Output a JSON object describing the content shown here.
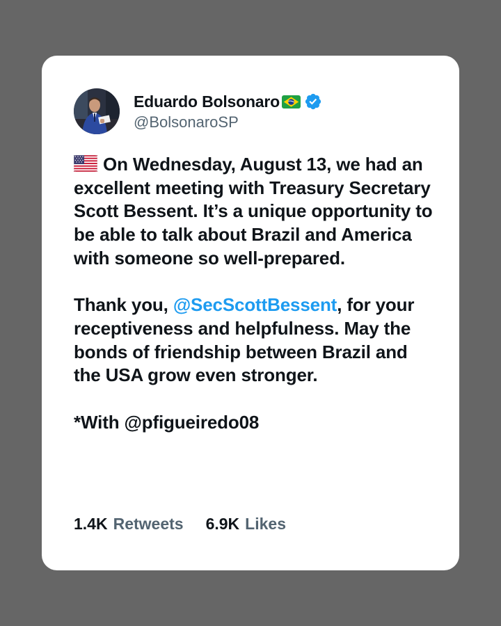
{
  "author": {
    "display_name": "Eduardo Bolsonaro",
    "handle": "@BolsonaroSP",
    "verified": true,
    "name_flag_icon": "brazil-flag-icon",
    "verified_icon": "verified-badge-icon"
  },
  "post": {
    "flag_icon": "usa-flag-icon",
    "paragraph1": "On Wednesday, August 13, we had an excellent meeting with Treasury Secretary Scott Bessent. It’s a unique opportunity to be able to talk about Brazil and America with someone so well-prepared.",
    "paragraph2_before": "Thank you, ",
    "paragraph2_mention": "@SecScottBessent",
    "paragraph2_after": ", for your receptiveness and helpfulness. May the bonds of friendship between Brazil and the USA grow even stronger.",
    "paragraph3": "*With @pfigueiredo08"
  },
  "stats": {
    "retweets_count": "1.4K",
    "retweets_label": "Retweets",
    "likes_count": "6.9K",
    "likes_label": "Likes"
  },
  "colors": {
    "background": "#666666",
    "card": "#ffffff",
    "text": "#0f1419",
    "secondary_text": "#536471",
    "mention": "#1d9bf0",
    "verified": "#1d9bf0"
  }
}
